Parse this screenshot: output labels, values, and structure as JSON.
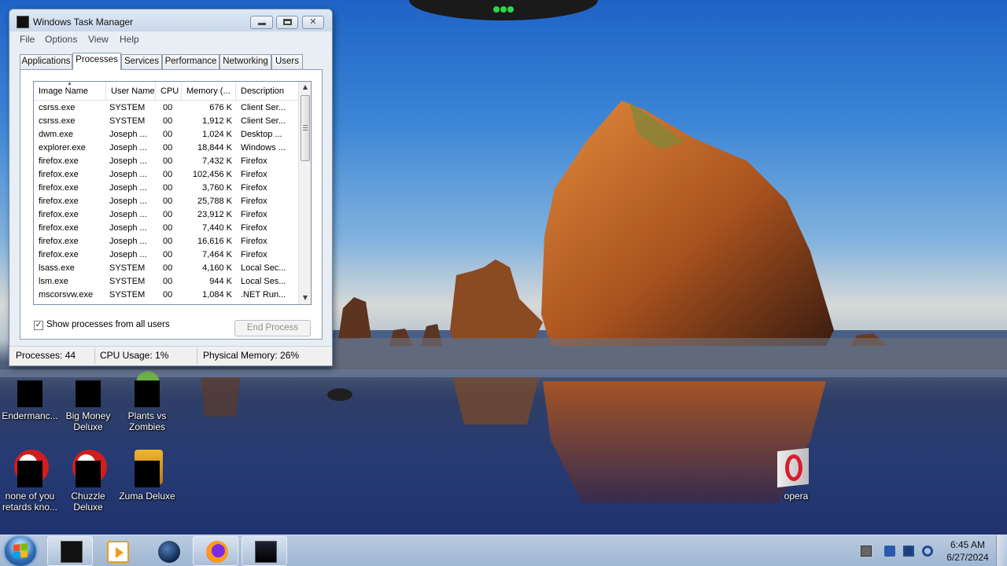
{
  "window": {
    "title": "Windows Task Manager",
    "controls": {
      "minimize": "",
      "maximize": "",
      "close": "✕"
    },
    "menu": [
      "File",
      "Options",
      "View",
      "Help"
    ],
    "tabs": [
      "Applications",
      "Processes",
      "Services",
      "Performance",
      "Networking",
      "Users"
    ],
    "active_tab": "Processes",
    "columns": [
      "Image Name",
      "User Name",
      "CPU",
      "Memory (...",
      "Description"
    ],
    "processes": [
      {
        "name": "csrss.exe",
        "user": "SYSTEM",
        "cpu": "00",
        "mem": "676 K",
        "desc": "Client Ser..."
      },
      {
        "name": "csrss.exe",
        "user": "SYSTEM",
        "cpu": "00",
        "mem": "1,912 K",
        "desc": "Client Ser..."
      },
      {
        "name": "dwm.exe",
        "user": "Joseph ...",
        "cpu": "00",
        "mem": "1,024 K",
        "desc": "Desktop ..."
      },
      {
        "name": "explorer.exe",
        "user": "Joseph ...",
        "cpu": "00",
        "mem": "18,844 K",
        "desc": "Windows ..."
      },
      {
        "name": "firefox.exe",
        "user": "Joseph ...",
        "cpu": "00",
        "mem": "7,432 K",
        "desc": "Firefox"
      },
      {
        "name": "firefox.exe",
        "user": "Joseph ...",
        "cpu": "00",
        "mem": "102,456 K",
        "desc": "Firefox"
      },
      {
        "name": "firefox.exe",
        "user": "Joseph ...",
        "cpu": "00",
        "mem": "3,760 K",
        "desc": "Firefox"
      },
      {
        "name": "firefox.exe",
        "user": "Joseph ...",
        "cpu": "00",
        "mem": "25,788 K",
        "desc": "Firefox"
      },
      {
        "name": "firefox.exe",
        "user": "Joseph ...",
        "cpu": "00",
        "mem": "23,912 K",
        "desc": "Firefox"
      },
      {
        "name": "firefox.exe",
        "user": "Joseph ...",
        "cpu": "00",
        "mem": "7,440 K",
        "desc": "Firefox"
      },
      {
        "name": "firefox.exe",
        "user": "Joseph ...",
        "cpu": "00",
        "mem": "16,616 K",
        "desc": "Firefox"
      },
      {
        "name": "firefox.exe",
        "user": "Joseph ...",
        "cpu": "00",
        "mem": "7,464 K",
        "desc": "Firefox"
      },
      {
        "name": "lsass.exe",
        "user": "SYSTEM",
        "cpu": "00",
        "mem": "4,160 K",
        "desc": "Local Sec..."
      },
      {
        "name": "lsm.exe",
        "user": "SYSTEM",
        "cpu": "00",
        "mem": "944 K",
        "desc": "Local Ses..."
      },
      {
        "name": "mscorsvw.exe",
        "user": "SYSTEM",
        "cpu": "00",
        "mem": "1,084 K",
        "desc": ".NET Run..."
      }
    ],
    "show_all_label": "Show processes from all users",
    "show_all_checked": true,
    "end_process_label": "End Process",
    "status": {
      "processes": "Processes: 44",
      "cpu": "CPU Usage: 1%",
      "memory": "Physical Memory: 26%"
    }
  },
  "desktop_icons": [
    {
      "label": "Endermanc...",
      "icon": "document-icon"
    },
    {
      "label": "Big Money Deluxe",
      "icon": "game-icon"
    },
    {
      "label": "Plants vs Zombies",
      "icon": "game-icon"
    },
    {
      "label": "none of you retards kno...",
      "icon": "red-circle-icon"
    },
    {
      "label": "Chuzzle Deluxe",
      "icon": "game-icon"
    },
    {
      "label": "Zuma Deluxe",
      "icon": "game-icon"
    },
    {
      "label": "opera",
      "icon": "opera-icon"
    }
  ],
  "taskbar": {
    "apps": [
      "terminal-icon",
      "media-player-icon",
      "globe-icon",
      "firefox-icon",
      "task-manager-icon"
    ],
    "tray": [
      "document-icon",
      "flag-icon",
      "monitor-icon",
      "network-icon"
    ],
    "time": "6:45 AM",
    "date": "6/27/2024"
  },
  "colors": {
    "window_frame": "#e9eef5",
    "taskbar": "#b9cbe0",
    "sky": "#3d86d6",
    "rock": "#b9642a"
  }
}
